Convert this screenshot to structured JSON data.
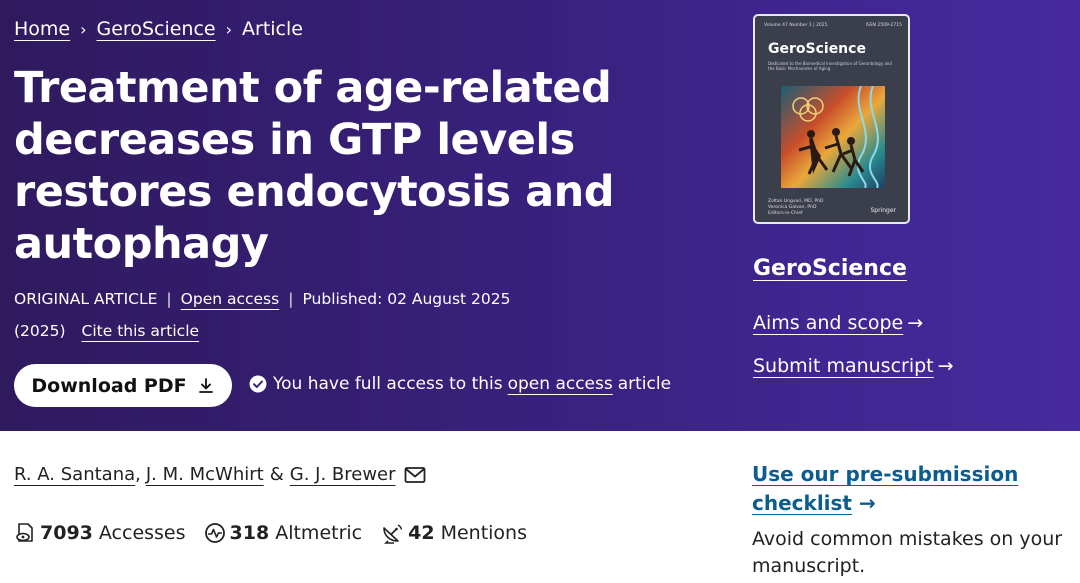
{
  "breadcrumb": {
    "home": "Home",
    "journal": "GeroScience",
    "current": "Article",
    "separator": "›"
  },
  "article": {
    "title": "Treatment of age-related decreases in GTP levels restores endocytosis and autophagy",
    "type": "ORIGINAL ARTICLE",
    "open_access": "Open access",
    "published": "Published: 02 August 2025",
    "year": "(2025)",
    "cite": "Cite this article"
  },
  "download": {
    "label": "Download PDF",
    "icon": "download-icon"
  },
  "access": {
    "prefix": "You have full access to this",
    "link": "open access",
    "suffix": "article",
    "icon": "check-circle-icon"
  },
  "cover": {
    "volume": "Volume 47 Number 1 | 2025",
    "issn": "ISSN 2509-2715",
    "journal": "GeroScience",
    "subtitle": "Dedicated to the Biomedical Investigation of Gerontology and the Basic Mechanisms of Aging",
    "editor1": "Zoltan Ungvari, MD, PhD",
    "editor2": "Veronica Galvan, PhD",
    "editors_label": "Editors-in-Chief",
    "publisher": "Springer"
  },
  "sidebar": {
    "journal": "GeroScience",
    "aims": "Aims and scope",
    "submit": "Submit manuscript",
    "arrow": "→",
    "checklist": "Use our pre-submission checklist",
    "checklist_arrow": "→",
    "avoid": "Avoid common mistakes on your manuscript."
  },
  "authors": {
    "a1": "R. A. Santana",
    "sep1": ",",
    "a2": "J. M. McWhirt",
    "amp": "&",
    "a3": "G. J. Brewer",
    "icon": "envelope-icon"
  },
  "metrics": {
    "accesses_value": "7093",
    "accesses_label": "Accesses",
    "altmetric_value": "318",
    "altmetric_label": "Altmetric",
    "mentions_value": "42",
    "mentions_label": "Mentions"
  },
  "colors": {
    "hero_start": "#2f1a5e",
    "hero_end": "#462a9e",
    "link_blue": "#0c5d8f"
  }
}
